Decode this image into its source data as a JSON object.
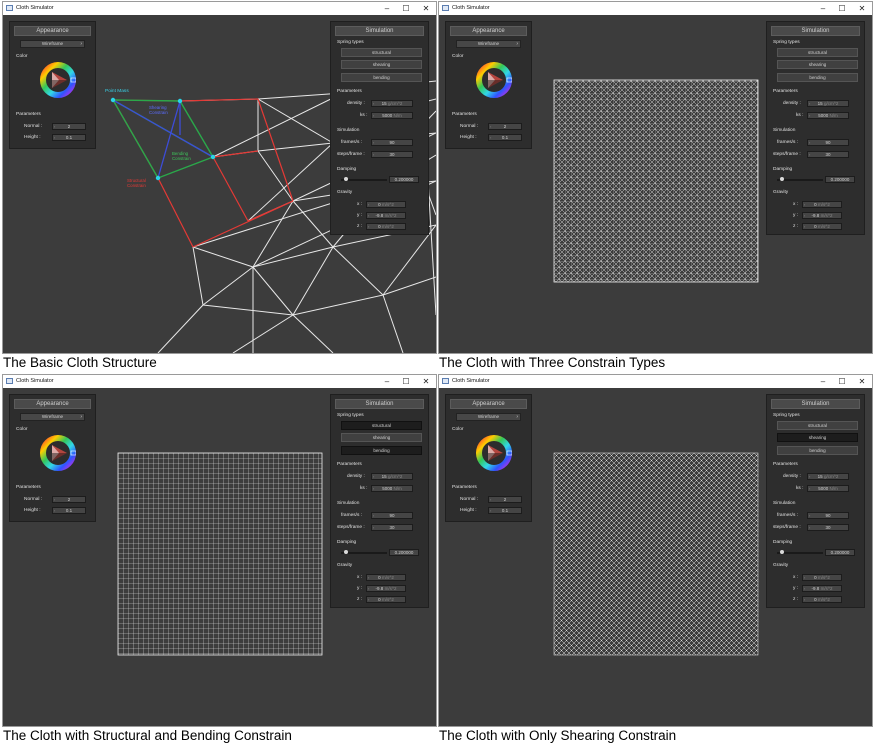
{
  "window": {
    "title": "Cloth Simulator",
    "minimize": "–",
    "maximize": "☐",
    "close": "✕"
  },
  "appearance": {
    "header": "Appearance",
    "shader": "Wireframe",
    "color_label": "Color",
    "parameters_label": "Parameters",
    "normal_label": "Normal :",
    "normal_value": "2",
    "height_label": "Height :",
    "height_value": "0.1"
  },
  "simulation": {
    "header": "Simulation",
    "spring_types_label": "Spring types",
    "structural": "structural",
    "shearing": "shearing",
    "bending": "bending",
    "parameters_label": "Parameters",
    "density_label": "density :",
    "density_value": "15",
    "density_unit": "g/cm^2",
    "ks_label": "ks :",
    "ks_value": "5000",
    "ks_unit": "N/m",
    "simulation_label": "Simulation",
    "frames_label": "frames/s :",
    "frames_value": "90",
    "steps_label": "steps/frame :",
    "steps_value": "30",
    "damping_label": "Damping",
    "damping_value": "0.200000",
    "damping_level": 0.1,
    "gravity_label": "Gravity",
    "gx_label": "x :",
    "gx_value": "0",
    "gy_label": "y :",
    "gy_value": "-9.8",
    "gz_label": "z :",
    "gz_value": "0",
    "gravity_unit": "m/s^2"
  },
  "annotations": {
    "point_mass": "Point Mass",
    "shearing": "Shearing Constrain",
    "bending": "Bending Constrain",
    "structural": "Structural Constrain"
  },
  "captions": {
    "q1": "The Basic Cloth Structure",
    "q2": "The Cloth with Three Constrain Types",
    "q3": "The Cloth with Structural and Bending Constrain",
    "q4": "The Cloth with Only Shearing Constrain"
  },
  "icons": [
    "app-icon",
    "color-wheel-icon",
    "chevron-down-icon"
  ]
}
